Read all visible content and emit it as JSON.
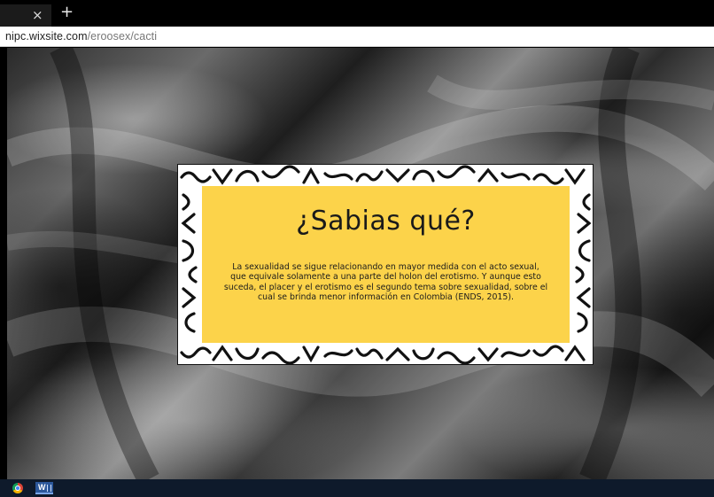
{
  "browser": {
    "tab_close_glyph": "×",
    "new_tab_glyph": "+",
    "url_host": "nipc.wixsite.com",
    "url_path": "/eroosex/cacti"
  },
  "card": {
    "title": "¿Sabias qué?",
    "body_lines": [
      "La sexualidad se sigue relacionando en mayor medida con el acto sexual,",
      "que equivale solamente a una parte del holon del erotismo. Y aunque esto",
      "suceda, el placer y el erotismo es el segundo tema sobre sexualidad, sobre el",
      "cual se brinda menor información en Colombia (ENDS, 2015)."
    ],
    "background_color": "#fcd34a",
    "pattern_color": "#111111"
  },
  "taskbar": {
    "icons": [
      "chrome-icon",
      "word-icon"
    ],
    "word_letter": "W"
  }
}
